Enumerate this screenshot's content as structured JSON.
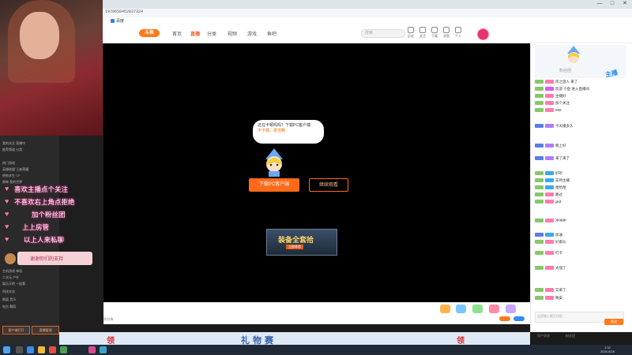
{
  "browser": {
    "url": "1970658452837324",
    "bookmark_label": "百度",
    "window_min": "—",
    "window_max": "□",
    "window_close": "✕"
  },
  "site": {
    "logo": "斗鱼",
    "nav": [
      "首页",
      "直播",
      "分类",
      "视频",
      "游戏",
      "鱼吧"
    ],
    "active_nav": "直播",
    "search_placeholder": "搜索",
    "header_icons": [
      "历史",
      "关注",
      "下载",
      "消息",
      "个人"
    ]
  },
  "player": {
    "bubble_line1": "还在卡顿吗吗？下载PC客户端",
    "bubble_line2": "不卡顿，更流畅",
    "download_button": "下载PC客户端",
    "continue_button": "继续观看",
    "ad_title": "装备全套拾",
    "ad_subtitle": "立即体验"
  },
  "gift_bar": {
    "note": "已领取 你有5张积分券"
  },
  "chat": {
    "title": "粉丝团",
    "badge": "主播",
    "rows": [
      "风之旅人 来了",
      "欢迎 小鱼 进入直播间",
      "主播好",
      "加个关注",
      "666",
      "今天播多久",
      "晚上好",
      "来了来了",
      "好听",
      "支持主播",
      "哈哈哈",
      "路过",
      "gkd",
      "冲冲冲",
      "加油",
      "好家伙",
      "打卡",
      "太强了",
      "又来了",
      "晚安"
    ],
    "input_placeholder": "这里输入聊天内容",
    "send_label": "发送",
    "footer_left": "用户状态",
    "footer_right": "粉丝团"
  },
  "overlay": {
    "lines": [
      "喜欢主播点个关注",
      "不喜欢右上角点拒绝",
      "加个粉丝团",
      "上上房管",
      "以上人来私聊"
    ],
    "goal_text": "谢谢你们的支持"
  },
  "left_panel": {
    "rows": [
      "我的关注  直播中",
      "推荐频道  分类",
      "热门游戏",
      "英雄联盟  王者荣耀",
      "绝地求生  CF",
      "原神  我的世界",
      "主机游戏  单机",
      "二次元  户外",
      "娱乐天地  一起看",
      "科技文化",
      "颜值  音乐",
      "电台  舞蹈"
    ],
    "btn1": "客户端打开",
    "btn2": "直播管理"
  },
  "bottom_banner": {
    "left": "领",
    "middle": "礼物赛",
    "right": "领"
  },
  "taskbar": {
    "time": "1:32",
    "date": "2021/4/28"
  }
}
